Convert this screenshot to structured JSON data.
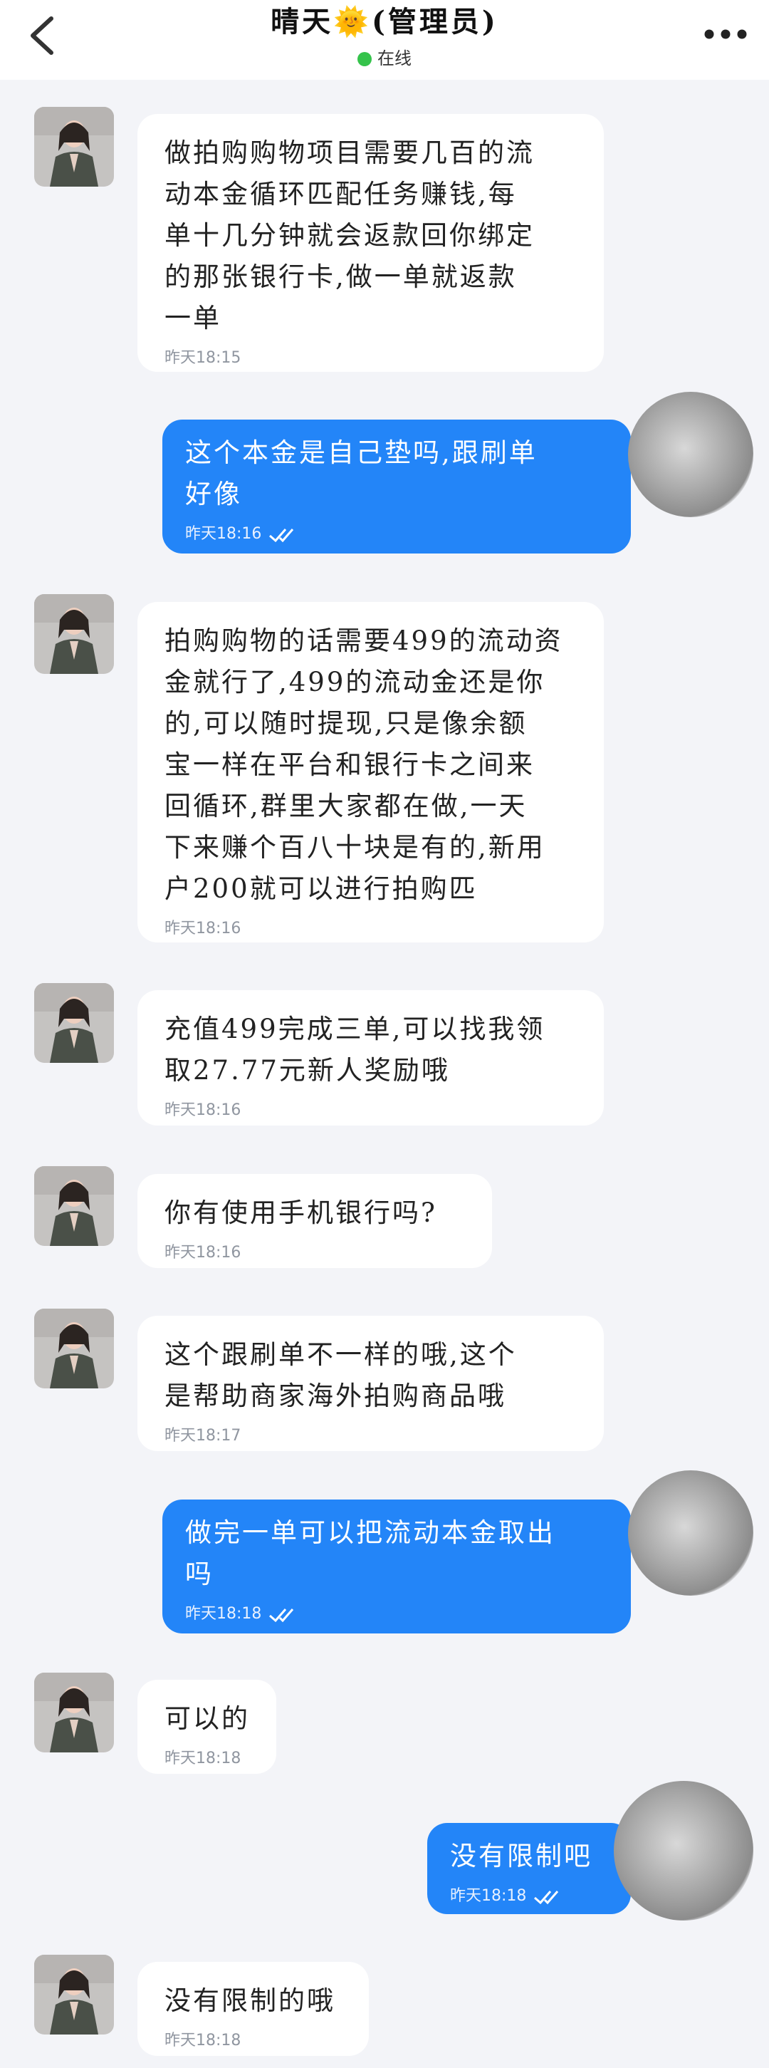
{
  "header": {
    "title": "晴天🌞(管理员)",
    "status": "在线"
  },
  "messages": [
    {
      "text": "做拍购购物项目需要几百的流\n动本金循环匹配任务赚钱,每\n单十几分钟就会返款回你绑定\n的那张银行卡,做一单就返款\n一单",
      "time": "昨天18:15"
    },
    {
      "text": "这个本金是自己垫吗,跟刷单\n好像",
      "time": "昨天18:16"
    },
    {
      "text": "拍购购物的话需要499的流动资\n金就行了,499的流动金还是你\n的,可以随时提现,只是像余额\n宝一样在平台和银行卡之间来\n回循环,群里大家都在做,一天\n下来赚个百八十块是有的,新用\n户200就可以进行拍购匹",
      "time": "昨天18:16"
    },
    {
      "text": "充值499完成三单,可以找我领\n取27.77元新人奖励哦",
      "time": "昨天18:16"
    },
    {
      "text": "你有使用手机银行吗?",
      "time": "昨天18:16"
    },
    {
      "text": "这个跟刷单不一样的哦,这个\n是帮助商家海外拍购商品哦",
      "time": "昨天18:17"
    },
    {
      "text": "做完一单可以把流动本金取出\n吗",
      "time": "昨天18:18"
    },
    {
      "text": "可以的",
      "time": "昨天18:18"
    },
    {
      "text": "没有限制吧",
      "time": "昨天18:18"
    },
    {
      "text": "没有限制的哦",
      "time": "昨天18:18"
    }
  ]
}
